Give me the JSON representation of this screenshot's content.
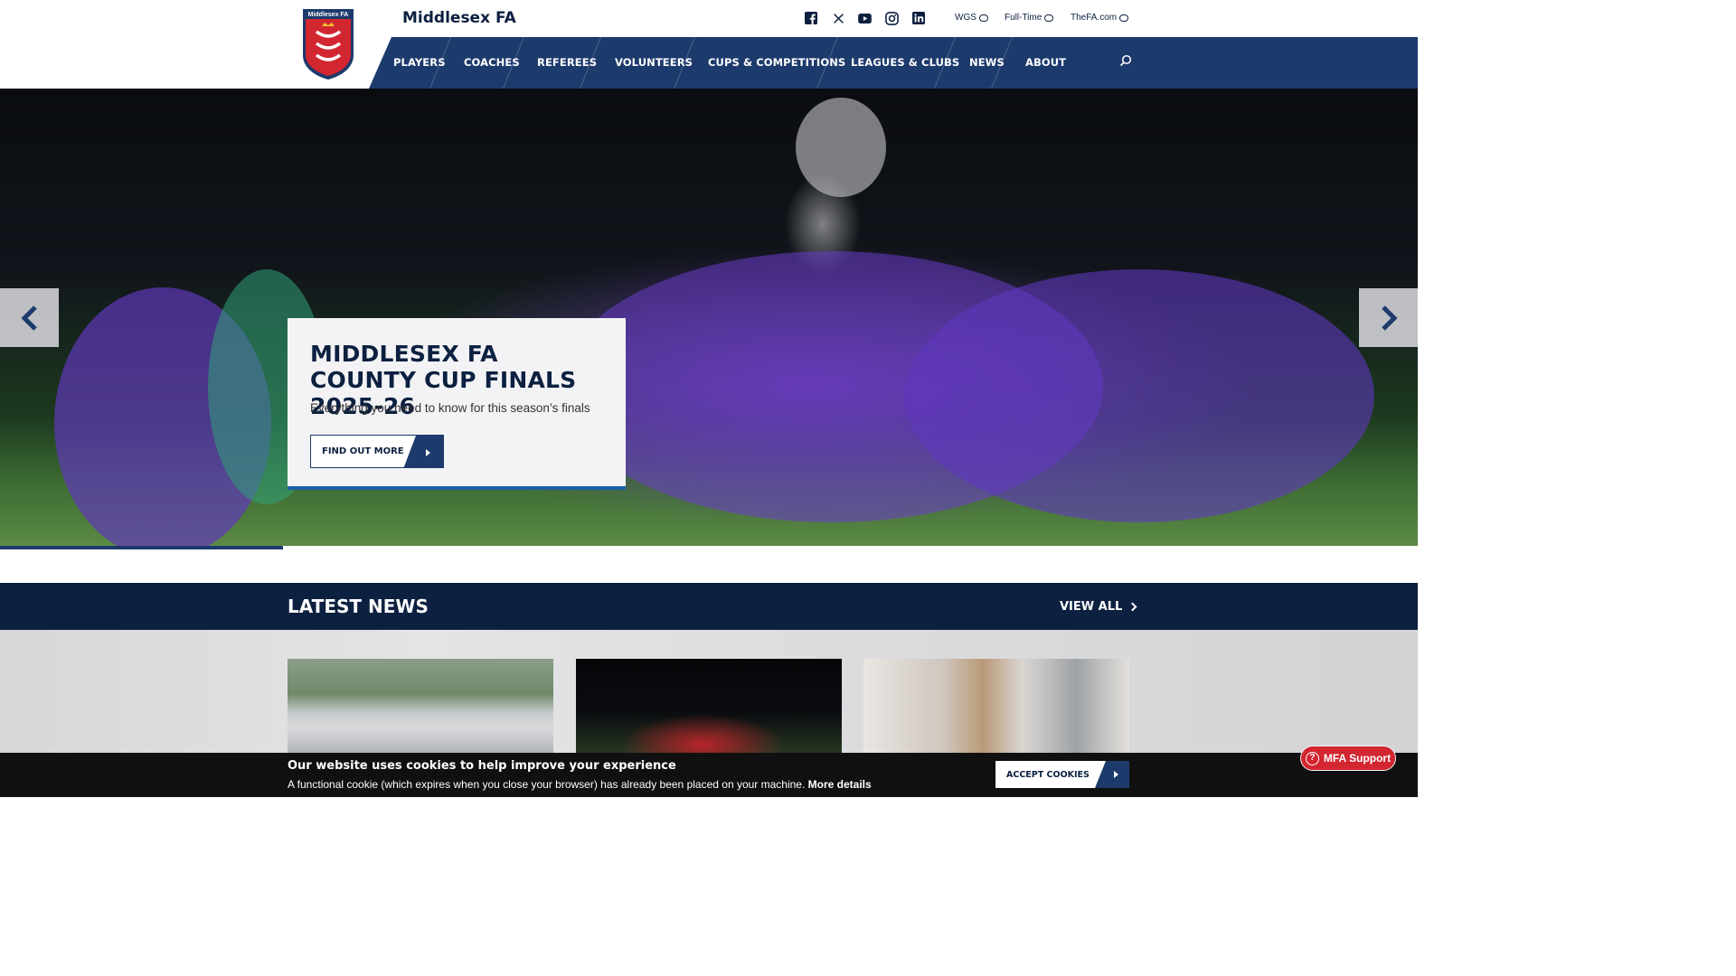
{
  "header": {
    "site_title": "Middlesex FA",
    "logo_text": "Middlesex FA",
    "social": [
      "facebook-icon",
      "x-icon",
      "youtube-icon",
      "instagram-icon",
      "linkedin-icon"
    ],
    "external_links": [
      {
        "label": "WGS"
      },
      {
        "label": "Full-Time"
      },
      {
        "label": "TheFA.com"
      }
    ]
  },
  "nav": {
    "items": [
      "PLAYERS",
      "COACHES",
      "REFEREES",
      "VOLUNTEERS",
      "CUPS & COMPETITIONS",
      "LEAGUES & CLUBS",
      "NEWS",
      "ABOUT"
    ]
  },
  "hero": {
    "title": "MIDDLESEX FA COUNTY CUP FINALS 2025-26",
    "subtitle": "Everything you need to know for this season’s finals",
    "cta_label": "FIND OUT MORE"
  },
  "latest_news": {
    "heading": "LATEST NEWS",
    "view_all": "VIEW ALL"
  },
  "cookie_banner": {
    "title": "Our website uses cookies to help improve your experience",
    "text": "A functional cookie (which expires when you close your browser) has already been placed on your machine.",
    "more_link": "More details",
    "accept_label": "ACCEPT COOKIES"
  },
  "support": {
    "label": "MFA Support"
  },
  "colors": {
    "navy": "#1d3a6c",
    "dark_navy": "#0c2040",
    "accent_blue": "#1d5ea8",
    "support_red": "#d22630"
  }
}
